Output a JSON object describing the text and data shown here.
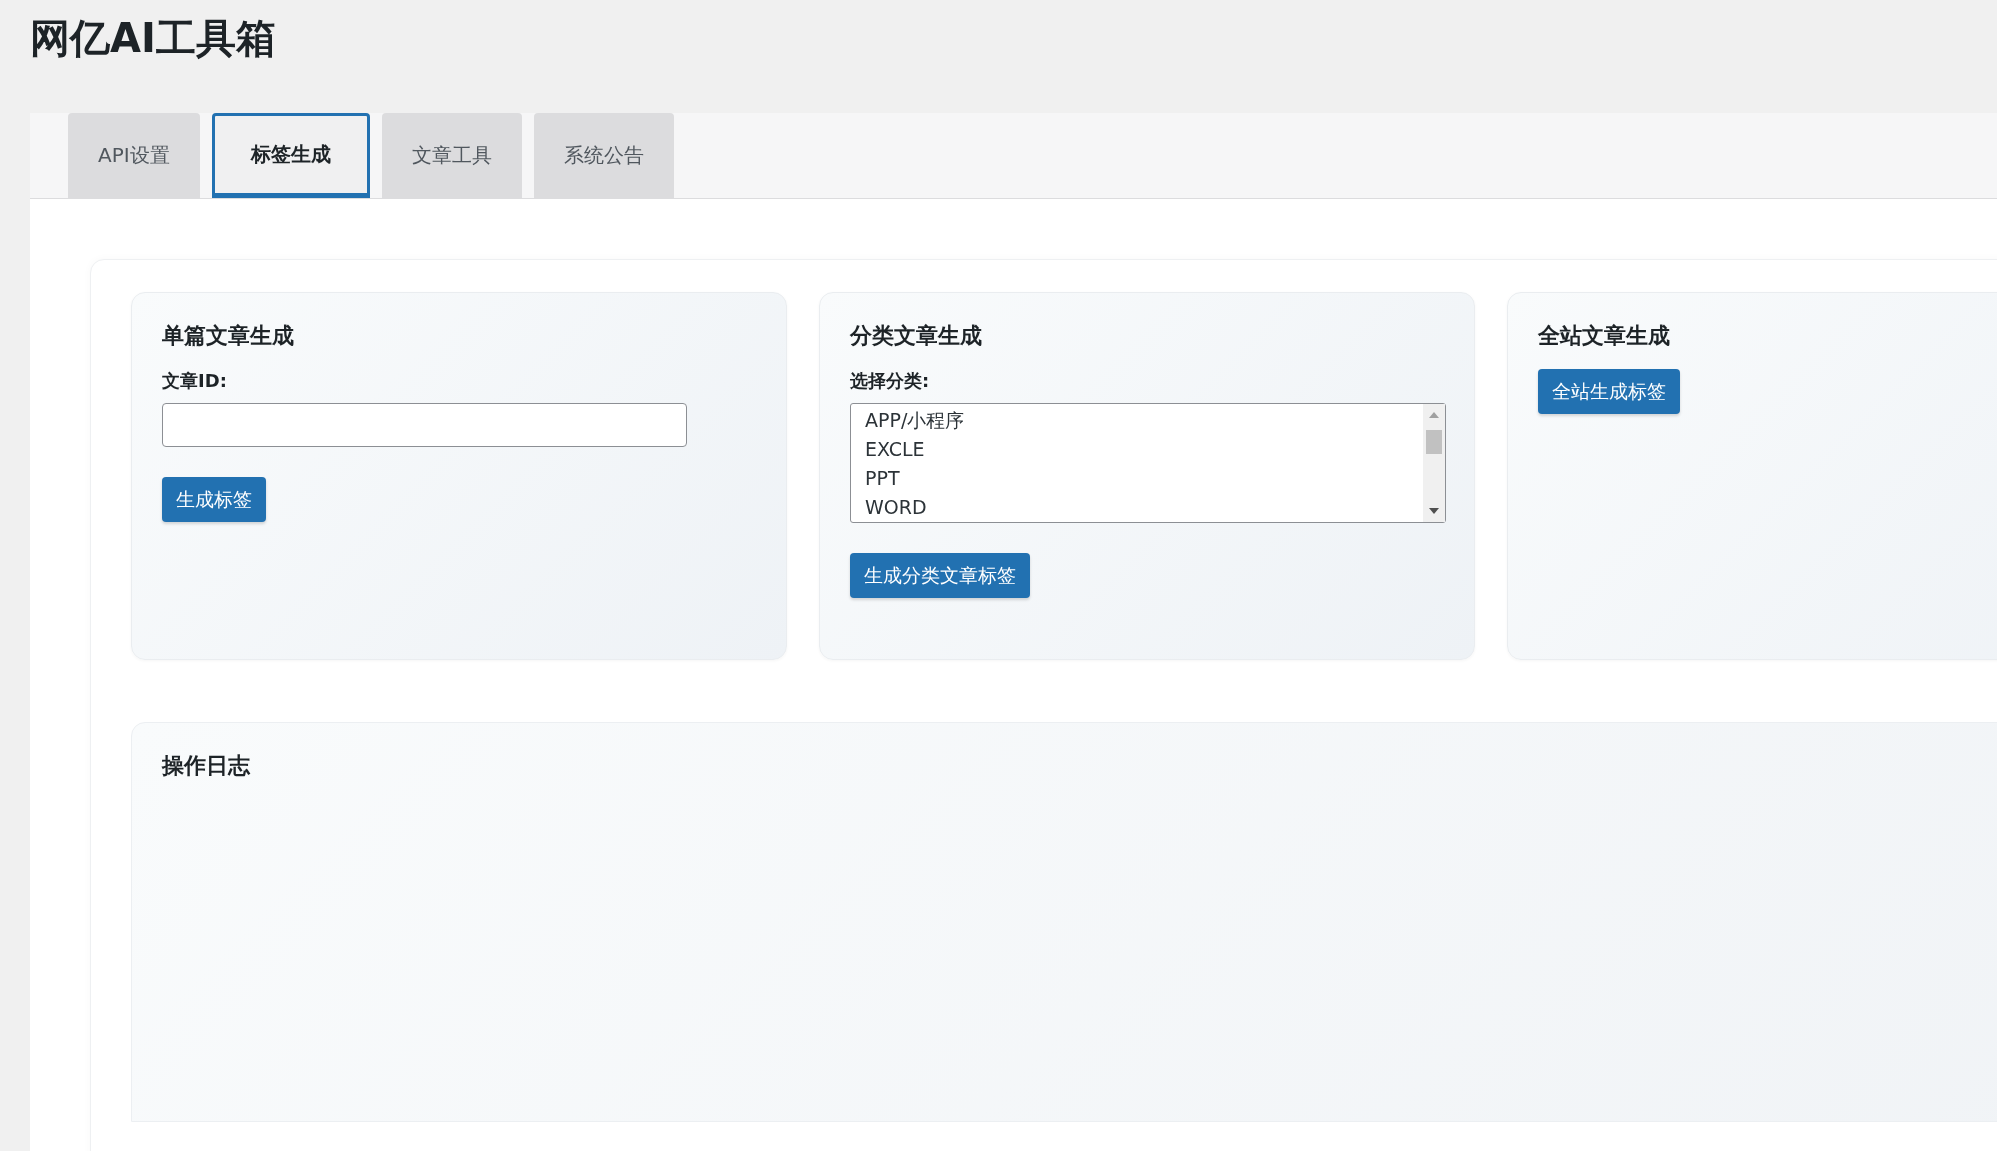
{
  "title": "网亿AI工具箱",
  "tabs": [
    {
      "label": "API设置",
      "selected": false
    },
    {
      "label": "标签生成",
      "selected": true
    },
    {
      "label": "文章工具",
      "selected": false
    },
    {
      "label": "系统公告",
      "selected": false
    }
  ],
  "cards": [
    {
      "kind": "id-input",
      "title": "单篇文章生成",
      "label": "文章ID:",
      "button": "生成标签"
    },
    {
      "kind": "category-list",
      "title": "分类文章生成",
      "label": "选择分类:",
      "options": [
        "APP/小程序",
        "EXCLE",
        "PPT",
        "WORD"
      ],
      "button": "生成分类文章标签"
    },
    {
      "kind": "button-only",
      "title": "全站文章生成",
      "button": "全站生成标签"
    }
  ],
  "log": {
    "title": "操作日志"
  }
}
